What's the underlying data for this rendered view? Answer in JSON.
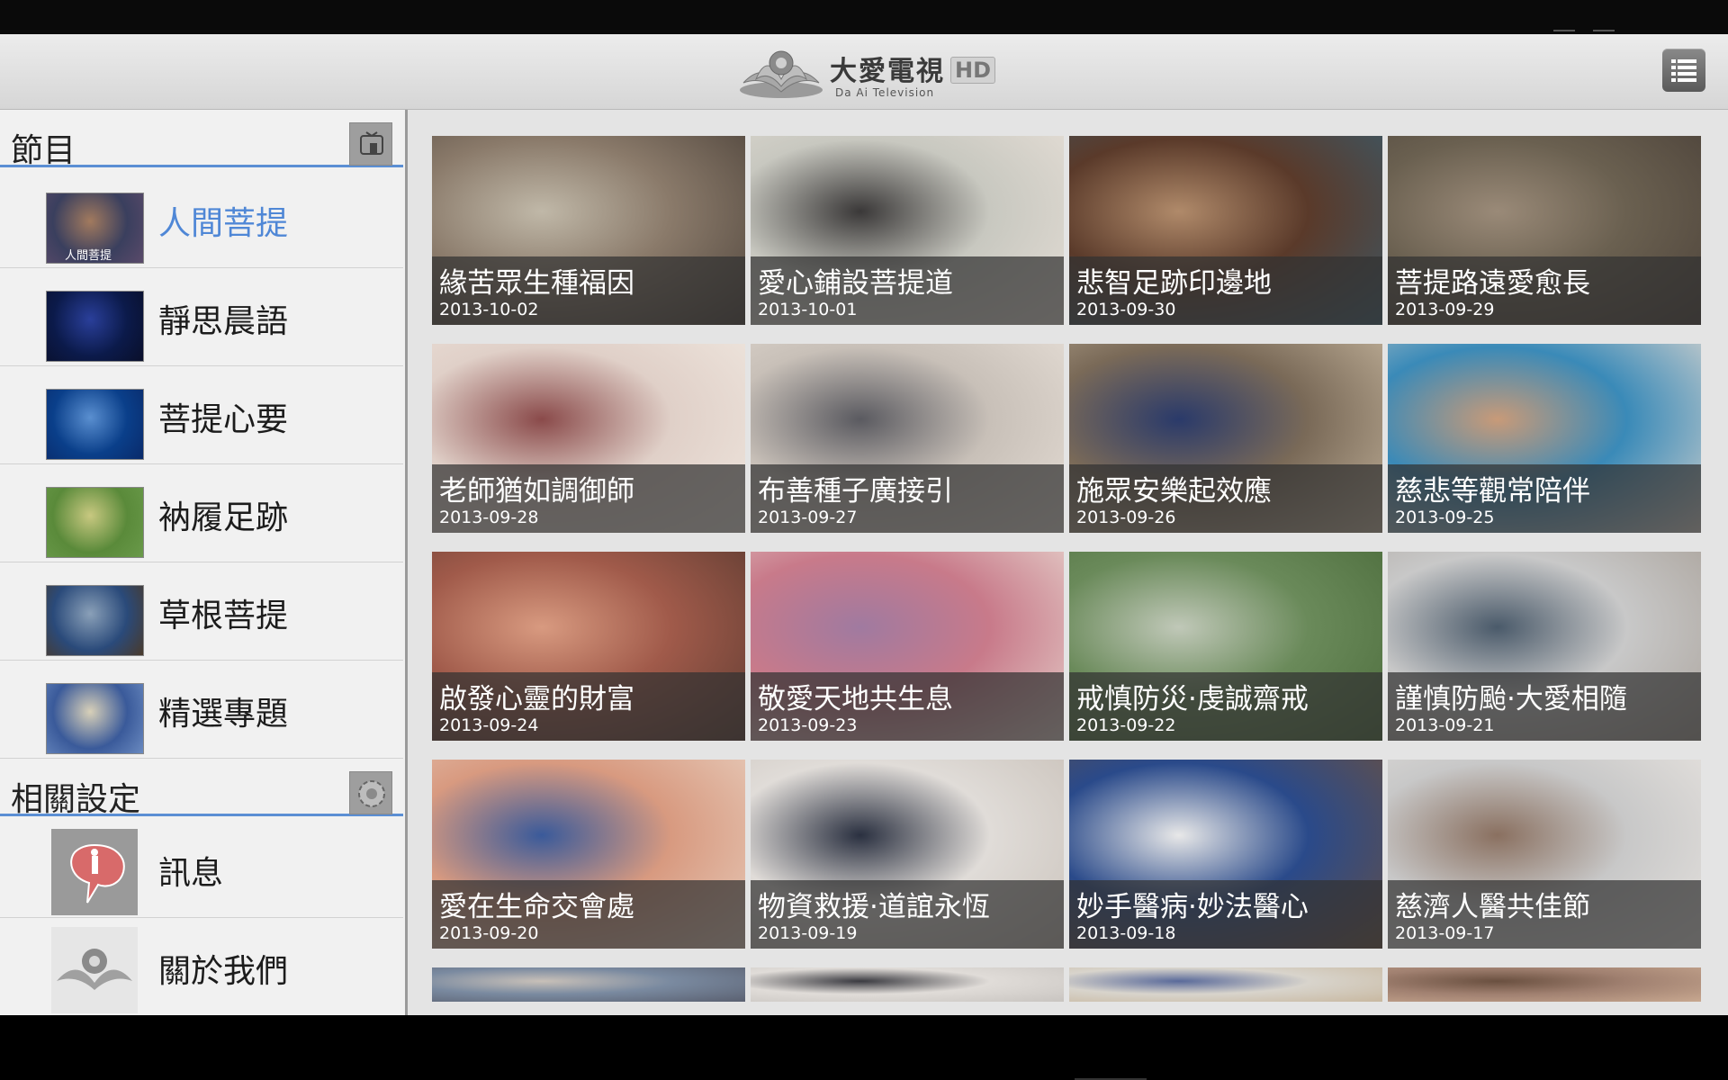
{
  "app": {
    "logo_text": "大愛電視",
    "logo_badge": "HD",
    "logo_subtitle": "Da Ai Television"
  },
  "sidebar": {
    "programs_header": "節目",
    "programs": [
      {
        "label": "人間菩提",
        "active": true,
        "thumb_colors": [
          "#3a3f5e",
          "#a27a5e",
          "#5a4a6a"
        ],
        "thumb_caption": "人間菩提"
      },
      {
        "label": "靜思晨語",
        "active": false,
        "thumb_colors": [
          "#0b1a4a",
          "#2a3f9a",
          "#0a0f2a"
        ]
      },
      {
        "label": "菩提心要",
        "active": false,
        "thumb_colors": [
          "#0a3f8a",
          "#5a8fd0",
          "#0a2a6a"
        ]
      },
      {
        "label": "衲履足跡",
        "active": false,
        "thumb_colors": [
          "#5a8a3a",
          "#c8c880",
          "#6a9a4a"
        ]
      },
      {
        "label": "草根菩提",
        "active": false,
        "thumb_colors": [
          "#2a4a7a",
          "#8aa0b8",
          "#4a3a2a"
        ]
      },
      {
        "label": "精選專題",
        "active": false,
        "thumb_colors": [
          "#3a5a9a",
          "#d8d0b8",
          "#6a8ac0"
        ]
      }
    ],
    "settings_header": "相關設定",
    "settings": [
      {
        "label": "訊息"
      },
      {
        "label": "關於我們"
      }
    ]
  },
  "videos": [
    {
      "title": "緣苦眾生種福因",
      "date": "2013-10-02",
      "colors": [
        "#8a7a6a",
        "#c0b8a8",
        "#4a4038"
      ]
    },
    {
      "title": "愛心鋪設菩提道",
      "date": "2013-10-01",
      "colors": [
        "#c8c8c0",
        "#3a3838",
        "#e8e0d8"
      ]
    },
    {
      "title": "悲智足跡印邊地",
      "date": "2013-09-30",
      "colors": [
        "#5a3a2a",
        "#b08a6a",
        "#3a5a6a"
      ]
    },
    {
      "title": "菩提路遠愛愈長",
      "date": "2013-09-29",
      "colors": [
        "#6a6050",
        "#9a8a78",
        "#4a4038"
      ]
    },
    {
      "title": "老師猶如調御師",
      "date": "2013-09-28",
      "colors": [
        "#e0d0c8",
        "#8a4a4a",
        "#f0e8e0"
      ]
    },
    {
      "title": "布善種子廣接引",
      "date": "2013-09-27",
      "colors": [
        "#c8c0b8",
        "#5a5a60",
        "#e8e0d8"
      ]
    },
    {
      "title": "施眾安樂起效應",
      "date": "2013-09-26",
      "colors": [
        "#7a6a58",
        "#2a3a6a",
        "#c8b8a0"
      ]
    },
    {
      "title": "慈悲等觀常陪伴",
      "date": "2013-09-25",
      "colors": [
        "#3a8ab8",
        "#c89a78",
        "#e0d8d0"
      ]
    },
    {
      "title": "啟發心靈的財富",
      "date": "2013-09-24",
      "colors": [
        "#a05a4a",
        "#d89a80",
        "#5a3a30"
      ]
    },
    {
      "title": "敬愛天地共生息",
      "date": "2013-09-23",
      "colors": [
        "#c87a8a",
        "#a07aa0",
        "#e8d8d0"
      ]
    },
    {
      "title": "戒慎防災·虔誠齋戒",
      "date": "2013-09-22",
      "colors": [
        "#6a8a5a",
        "#c0c8b8",
        "#4a6a3a"
      ]
    },
    {
      "title": "謹慎防颱·大愛相隨",
      "date": "2013-09-21",
      "colors": [
        "#c8c8c8",
        "#4a5a6a",
        "#a8a098"
      ]
    },
    {
      "title": "愛在生命交會處",
      "date": "2013-09-20",
      "colors": [
        "#d89a80",
        "#3a5a9a",
        "#e8d0c0"
      ]
    },
    {
      "title": "物資救援·道誼永恆",
      "date": "2013-09-19",
      "colors": [
        "#e0dcd8",
        "#2a3040",
        "#c8c0b8"
      ]
    },
    {
      "title": "妙手醫病·妙法醫心",
      "date": "2013-09-18",
      "colors": [
        "#2a4a8a",
        "#e8e8e8",
        "#6a5040"
      ]
    },
    {
      "title": "慈濟人醫共佳節",
      "date": "2013-09-17",
      "colors": [
        "#c8c8c8",
        "#8a7060",
        "#e8e4e0"
      ]
    },
    {
      "title": "",
      "date": "",
      "colors": [
        "#7a8aa0",
        "#c8c0b8",
        "#5a6070"
      ]
    },
    {
      "title": "",
      "date": "",
      "colors": [
        "#e0dcd8",
        "#3a3a40",
        "#c8c4c0"
      ]
    },
    {
      "title": "",
      "date": "",
      "colors": [
        "#d8d4cc",
        "#5a6a9a",
        "#c8b8a0"
      ]
    },
    {
      "title": "",
      "date": "",
      "colors": [
        "#a08070",
        "#6a5040",
        "#c8a890"
      ]
    }
  ]
}
